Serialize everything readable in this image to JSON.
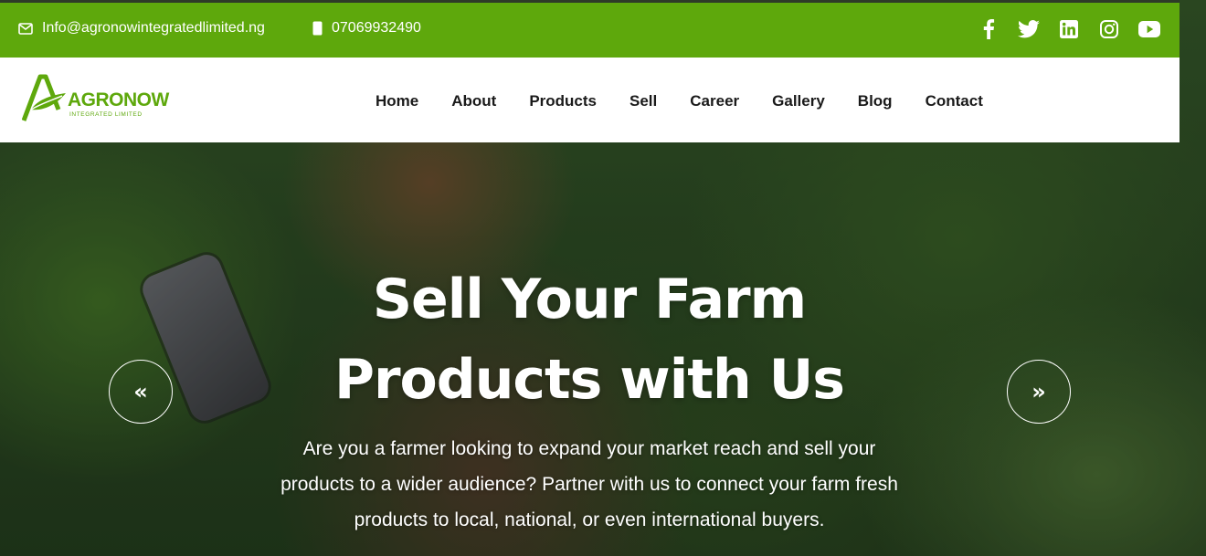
{
  "topbar": {
    "email": "Info@agronowintegratedlimited.ng",
    "phone": "07069932490",
    "social": [
      "facebook-icon",
      "twitter-icon",
      "linkedin-icon",
      "instagram-icon",
      "youtube-icon"
    ]
  },
  "logo": {
    "name": "AGRONOW",
    "tagline": "INTEGRATED LIMITED"
  },
  "nav": {
    "items": [
      "Home",
      "About",
      "Products",
      "Sell",
      "Career",
      "Gallery",
      "Blog",
      "Contact"
    ]
  },
  "hero": {
    "title_line1": "Sell Your Farm",
    "title_line2": "Products with Us",
    "description": "Are you a farmer looking to expand your market reach and sell your products to a wider audience? Partner with us to connect your farm fresh products to local, national, or even international buyers.",
    "prev_label": "«",
    "next_label": "»"
  },
  "colors": {
    "brand_green": "#5ea80c",
    "nav_text": "#1a1a1a",
    "hero_text": "#ffffff"
  }
}
